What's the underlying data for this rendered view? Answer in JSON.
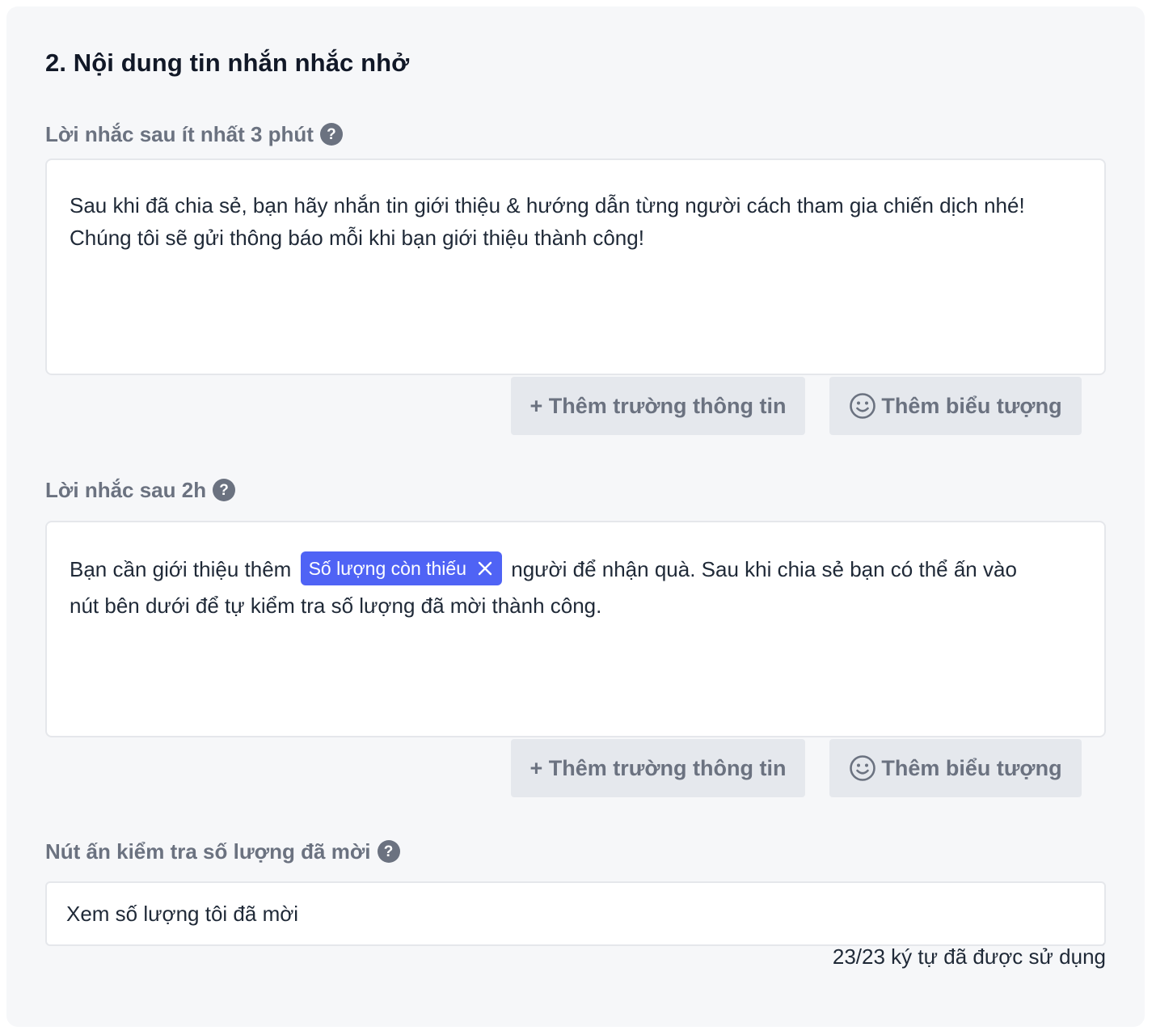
{
  "section": {
    "title": "2. Nội dung tin nhắn nhắc nhở"
  },
  "reminder_1": {
    "label": "Lời nhắc sau ít nhất 3 phút",
    "help": "?",
    "text_line_1": "Sau khi đã chia sẻ, bạn hãy nhắn tin giới thiệu & hướng dẫn từng người cách tham gia chiến dịch nhé!",
    "text_line_2": "Chúng tôi sẽ gửi thông báo mỗi khi bạn giới thiệu thành công!",
    "add_field_label": "+ Thêm trường thông tin",
    "add_emoji_label": "Thêm biểu tượng"
  },
  "reminder_2": {
    "label": "Lời nhắc sau 2h",
    "help": "?",
    "text_before_chip": "Bạn cần giới thiệu thêm",
    "chip_label": "Số lượng còn thiếu",
    "text_after_chip": "người để nhận quà. Sau khi chia sẻ bạn có thể ấn vào",
    "text_line_2": "nút bên dưới để tự kiểm tra số lượng đã mời thành công.",
    "add_field_label": "+ Thêm trường thông tin",
    "add_emoji_label": "Thêm biểu tượng"
  },
  "check_button": {
    "label": "Nút ấn kiểm tra số lượng đã mời",
    "help": "?",
    "value": "Xem số lượng tôi đã mời",
    "counter": "23/23 ký tự đã được sử dụng"
  },
  "colors": {
    "chip_bg": "#4f63f5",
    "card_bg": "#f6f7f9",
    "label": "#6b7280"
  }
}
